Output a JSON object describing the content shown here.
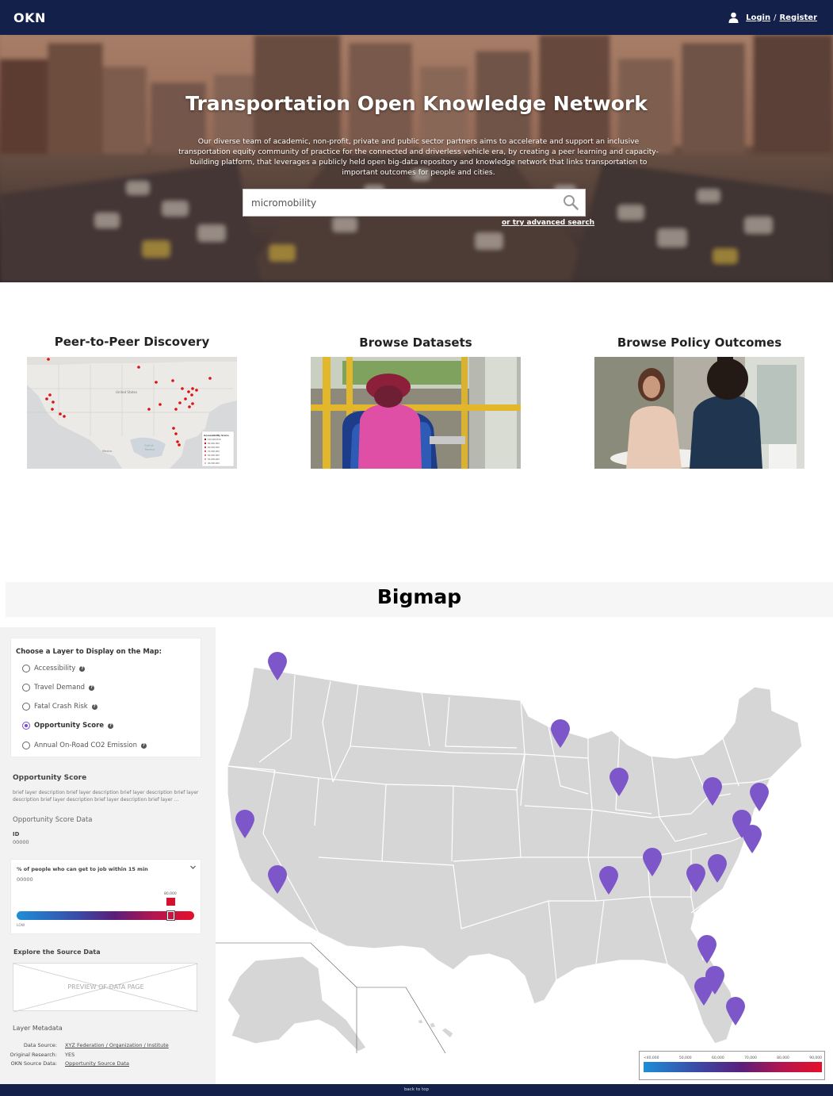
{
  "nav": {
    "brand": "OKN",
    "login": "Login",
    "separator": "/",
    "register": "Register"
  },
  "hero": {
    "title": "Transportation Open Knowledge Network",
    "description": "Our diverse team of academic, non-profit, private and public sector partners aims to accelerate and support an inclusive transportation equity community of practice for the connected and driverless vehicle era, by creating a peer learning and capacity-building platform, that leverages a publicly held open big-data repository and knowledge network that links transportation to important outcomes for people and cities.",
    "search_value": "micromobility",
    "advanced_search": "or try advanced search"
  },
  "cards": [
    {
      "title": "Peer-to-Peer Discovery"
    },
    {
      "title": "Browse Datasets"
    },
    {
      "title": "Browse Policy Outcomes"
    }
  ],
  "bigmap": {
    "title": "Bigmap",
    "layer_heading": "Choose a Layer to Display on the Map:",
    "layers": [
      {
        "label": "Accessibility",
        "selected": false
      },
      {
        "label": "Travel Demand",
        "selected": false
      },
      {
        "label": "Fatal Crash Risk",
        "selected": false
      },
      {
        "label": "Opportunity Score",
        "selected": true
      },
      {
        "label": "Annual On-Road CO2 Emission",
        "selected": false
      }
    ],
    "help_glyph": "?",
    "opportunity_title": "Opportunity Score",
    "opportunity_desc": "brief layer description brief layer description brief layer description brief layer description brief layer description brief layer description brief layer ...",
    "opportunity_data_label": "Opportunity Score Data",
    "id_label": "ID",
    "id_value": "00000",
    "slider": {
      "label": "% of people who can get to job within 15 min",
      "value": "00000",
      "flag_value": "80,000",
      "low_label": "LOW",
      "thumb_position": 0.88
    },
    "explore_title": "Explore the Source Data",
    "preview_text": "PREVIEW OF DATA PAGE",
    "metadata_heading": "Layer Metadata",
    "metadata": [
      {
        "key": "Data Source:",
        "value": "XYZ Federation / Organization / Institute",
        "link": true
      },
      {
        "key": "Original Research:",
        "value": "YES",
        "link": false
      },
      {
        "key": "OKN Source Data:",
        "value": "Opportunity Source Data",
        "link": true
      }
    ],
    "legend_labels": [
      "<40,000",
      "50,000",
      "60,000",
      "70,000",
      "80,000",
      "90,000"
    ]
  },
  "colors": {
    "nav": "#13204a",
    "pin": "#7d57c9",
    "map_fill": "#d6d6d6",
    "accent_red": "#e4102a",
    "accent_blue": "#1e8ed6"
  },
  "footer": {
    "back_to_top": "back to top"
  }
}
